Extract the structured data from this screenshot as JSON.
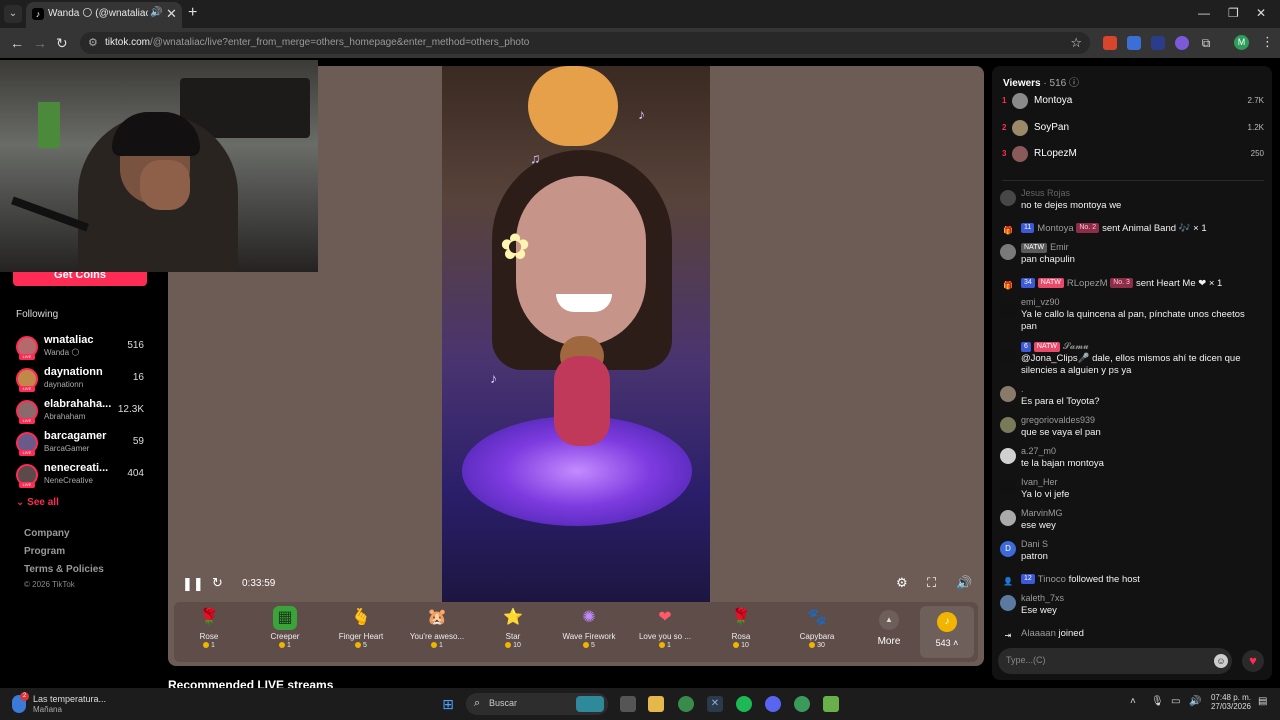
{
  "browser": {
    "tab_title": "Wanda 🌕 (@wnataliac) is LIVE",
    "tab_favicon": "♪",
    "new_tab_icon": "+",
    "url_host": "tiktok.com",
    "url_path": "/@wnataliac/live?enter_from_merge=others_homepage&enter_method=others_photo",
    "profile_initial": "M"
  },
  "sidebar": {
    "get_coins": "Get Coins",
    "following_title": "Following",
    "following": [
      {
        "name": "wnataliac",
        "sub": "Wanda 🌕",
        "count": "516",
        "color": "#b46a6a"
      },
      {
        "name": "daynationn",
        "sub": "daynationn",
        "count": "16",
        "color": "#c2884a"
      },
      {
        "name": "elabrahaha...",
        "sub": "Abrahaham",
        "count": "12.3K",
        "color": "#8a6a6a"
      },
      {
        "name": "barcagamer",
        "sub": "BarcaGamer",
        "count": "59",
        "color": "#6a5a8a"
      },
      {
        "name": "nenecreati...",
        "sub": "NeneCreative",
        "count": "404",
        "color": "#5a4a4a"
      }
    ],
    "see_all": "See all",
    "footer_links": [
      "Company",
      "Program",
      "Terms & Policies"
    ],
    "copyright": "© 2026 TikTok"
  },
  "player": {
    "time": "0:33:59"
  },
  "gifts": [
    {
      "name": "Rose",
      "price": "1",
      "icon": "🌹"
    },
    {
      "name": "Creeper",
      "price": "1",
      "icon": "▦"
    },
    {
      "name": "Finger Heart",
      "price": "5",
      "icon": "🫰"
    },
    {
      "name": "You're aweso...",
      "price": "1",
      "icon": "🐹"
    },
    {
      "name": "Star",
      "price": "10",
      "icon": "⭐"
    },
    {
      "name": "Wave Firework",
      "price": "5",
      "icon": "✺"
    },
    {
      "name": "Love you so ...",
      "price": "1",
      "icon": "❤"
    },
    {
      "name": "Rosa",
      "price": "10",
      "icon": "🌹"
    },
    {
      "name": "Capybara",
      "price": "30",
      "icon": "🐾"
    }
  ],
  "more_label": "More",
  "coin_balance": "543",
  "recommended_title": "Recommended LIVE streams",
  "chat": {
    "viewers_label": "Viewers",
    "viewers_count": "· 516",
    "top_viewers": [
      {
        "rank": "1",
        "name": "Montoya",
        "count": "2.7K"
      },
      {
        "rank": "2",
        "name": "SoyPan",
        "count": "1.2K"
      },
      {
        "rank": "3",
        "name": "RLopezM",
        "count": "250"
      }
    ],
    "messages": [
      {
        "user": "Jesus Rojas",
        "text": "no te dejes montoya we"
      },
      {
        "type": "gift",
        "level": "11",
        "user": "Montoya",
        "rank": "No. 2",
        "text": "sent Animal Band 🎶 × 1"
      },
      {
        "user": "Emir",
        "team": "NATW",
        "text": "pan chapulin"
      },
      {
        "type": "gift",
        "level": "34",
        "team": "NATW",
        "user": "RLopezM",
        "rank": "No. 3",
        "text": "sent Heart Me ❤ × 1"
      },
      {
        "user": "emi_vz90",
        "text": "Ya le callo la quincena al pan, pínchate unos cheetos pan"
      },
      {
        "user": "𝓢𝓪𝓶𝓾",
        "level": "6",
        "team": "NATW",
        "text": "@Jona_Clips🎤 dale, ellos mismos ahí te dicen que silencies a alguien y ps ya"
      },
      {
        "user": ".",
        "text": "Es para el Toyota?"
      },
      {
        "user": "gregoriovaldes939",
        "text": "que se vaya el pan"
      },
      {
        "user": "a.27_m0",
        "text": "te la bajan montoya"
      },
      {
        "user": "Ivan_Her",
        "text": "Ya lo vi jefe"
      },
      {
        "user": "MarvinMG",
        "text": "ese wey"
      },
      {
        "user": "Dani S",
        "initial": "D",
        "text": "patron"
      },
      {
        "type": "follow",
        "level": "12",
        "user": "Tinoco",
        "text": "followed the host"
      },
      {
        "user": "kaleth_7xs",
        "text": "Ese wey"
      },
      {
        "type": "join",
        "user": "Alaaaan",
        "text": "joined"
      }
    ],
    "input_placeholder": "Type...(C)"
  },
  "taskbar": {
    "weather_title": "Las temperatura...",
    "weather_sub": "Mañana",
    "weather_badge": "2",
    "search_placeholder": "Buscar",
    "time": "07:48 p. m.",
    "date": "27/03/2026"
  }
}
